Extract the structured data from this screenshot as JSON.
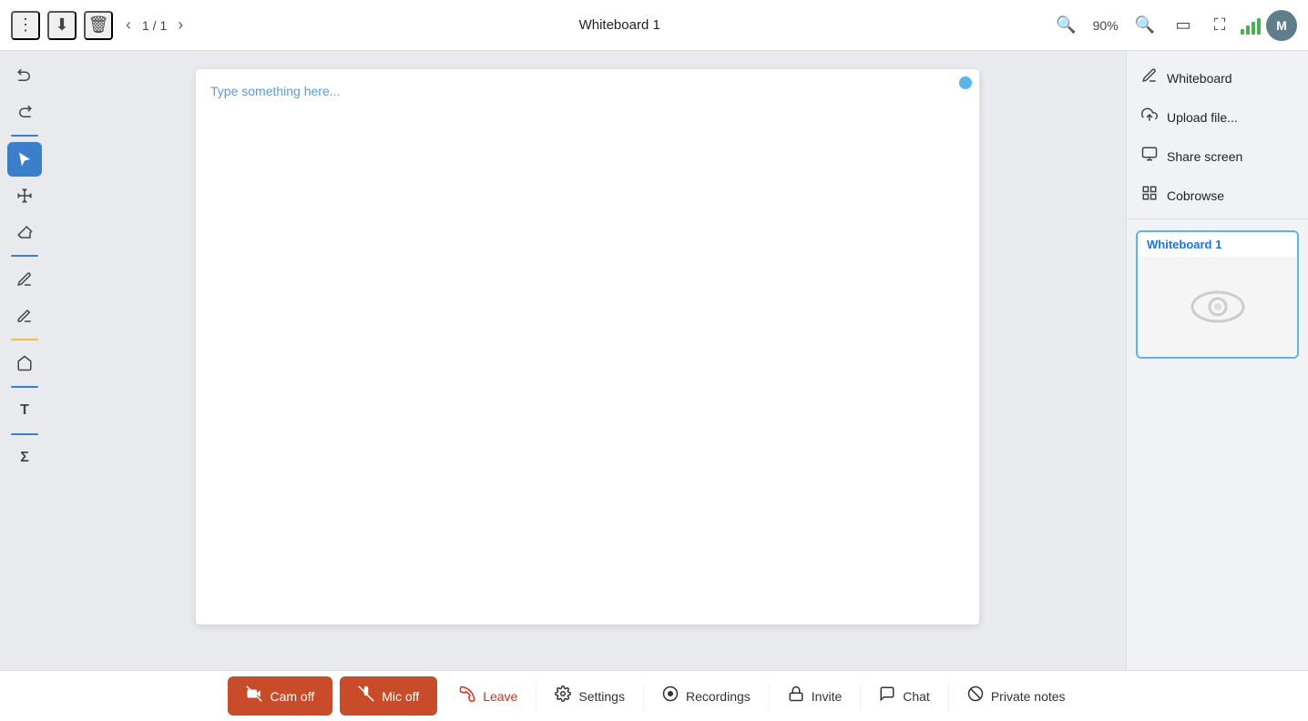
{
  "topToolbar": {
    "pageInfo": "1 / 1",
    "title": "Whiteboard 1",
    "zoomLevel": "90%",
    "avatarLabel": "M"
  },
  "leftToolbar": {
    "tools": [
      {
        "name": "undo",
        "icon": "↩",
        "label": "Undo"
      },
      {
        "name": "redo",
        "icon": "↪",
        "label": "Redo"
      },
      {
        "name": "select",
        "icon": "↖",
        "label": "Select",
        "active": true
      },
      {
        "name": "move",
        "icon": "✥",
        "label": "Move"
      },
      {
        "name": "eraser",
        "icon": "◻",
        "label": "Eraser"
      },
      {
        "name": "pen",
        "icon": "✎",
        "label": "Pen"
      },
      {
        "name": "highlighter",
        "icon": "✏",
        "label": "Highlighter"
      },
      {
        "name": "shapes",
        "icon": "⌂",
        "label": "Shapes"
      },
      {
        "name": "text",
        "icon": "T",
        "label": "Text"
      },
      {
        "name": "formula",
        "icon": "Σ",
        "label": "Formula"
      }
    ]
  },
  "canvas": {
    "placeholderText": "Type something here..."
  },
  "rightSidebar": {
    "items": [
      {
        "name": "whiteboard",
        "label": "Whiteboard",
        "icon": "✏"
      },
      {
        "name": "upload",
        "label": "Upload file...",
        "icon": "⬆"
      },
      {
        "name": "share-screen",
        "label": "Share screen",
        "icon": "🖥"
      },
      {
        "name": "cobrowse",
        "label": "Cobrowse",
        "icon": "⊞"
      }
    ],
    "whiteboardCard": {
      "title": "Whiteboard 1"
    }
  },
  "bottomToolbar": {
    "buttons": [
      {
        "name": "cam-off",
        "label": "Cam off",
        "icon": "📷",
        "style": "danger"
      },
      {
        "name": "mic-off",
        "label": "Mic off",
        "icon": "🎤",
        "style": "danger"
      },
      {
        "name": "leave",
        "label": "Leave",
        "icon": "📞",
        "style": "leave"
      },
      {
        "name": "settings",
        "label": "Settings",
        "icon": "⚙"
      },
      {
        "name": "recordings",
        "label": "Recordings",
        "icon": "⏺"
      },
      {
        "name": "invite",
        "label": "Invite",
        "icon": "🔒"
      },
      {
        "name": "chat",
        "label": "Chat",
        "icon": "💬"
      },
      {
        "name": "private-notes",
        "label": "Private notes",
        "icon": "🚫"
      }
    ]
  }
}
